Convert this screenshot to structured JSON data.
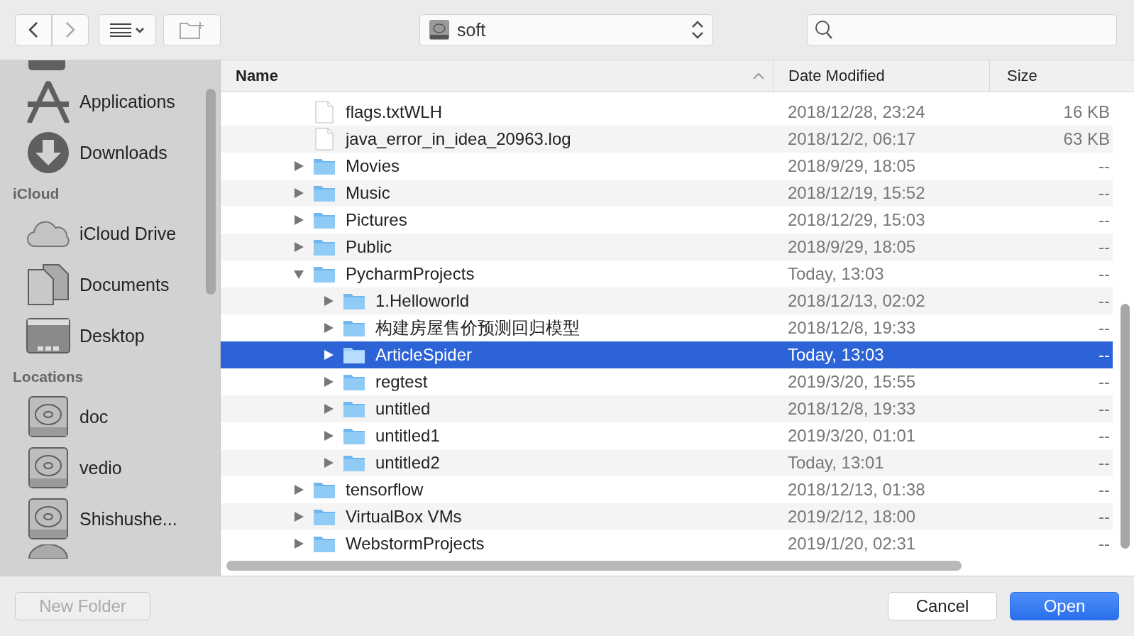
{
  "toolbar": {
    "location": "soft"
  },
  "sidebar": {
    "sections": [
      {
        "items": [
          {
            "label": "Applications",
            "kind": "apps"
          },
          {
            "label": "Downloads",
            "kind": "download"
          }
        ]
      },
      {
        "title": "iCloud",
        "items": [
          {
            "label": "iCloud Drive",
            "kind": "cloud"
          },
          {
            "label": "Documents",
            "kind": "documents"
          },
          {
            "label": "Desktop",
            "kind": "desktop"
          }
        ]
      },
      {
        "title": "Locations",
        "items": [
          {
            "label": "doc",
            "kind": "disk"
          },
          {
            "label": "vedio",
            "kind": "disk"
          },
          {
            "label": "Shishushe...",
            "kind": "disk"
          }
        ]
      }
    ]
  },
  "table": {
    "columns": [
      {
        "label": "Name",
        "sorted": true
      },
      {
        "label": "Date Modified",
        "sorted": false
      },
      {
        "label": "Size",
        "sorted": false
      }
    ],
    "rows": [
      {
        "name": "flags.txtWLH",
        "kind": "file",
        "date": "2018/12/28, 23:24",
        "size": "16 KB",
        "selected": false
      },
      {
        "name": "java_error_in_idea_20963.log",
        "kind": "file",
        "date": "2018/12/2, 06:17",
        "size": "63 KB",
        "selected": false
      },
      {
        "name": "Movies",
        "kind": "folder",
        "expanded": false,
        "date": "2018/9/29, 18:05",
        "size": "--",
        "selected": false
      },
      {
        "name": "Music",
        "kind": "folder",
        "expanded": false,
        "date": "2018/12/19, 15:52",
        "size": "--",
        "selected": false
      },
      {
        "name": "Pictures",
        "kind": "folder",
        "expanded": false,
        "date": "2018/12/29, 15:03",
        "size": "--",
        "selected": false
      },
      {
        "name": "Public",
        "kind": "folder",
        "expanded": false,
        "date": "2018/9/29, 18:05",
        "size": "--",
        "selected": false
      },
      {
        "name": "PycharmProjects",
        "kind": "folder",
        "expanded": true,
        "date": "Today, 13:03",
        "size": "--",
        "selected": false,
        "children": [
          {
            "name": "1.Helloworld",
            "kind": "folder",
            "expanded": false,
            "date": "2018/12/13, 02:02",
            "size": "--",
            "selected": false
          },
          {
            "name": "构建房屋售价预测回归模型",
            "kind": "folder",
            "expanded": false,
            "date": "2018/12/8, 19:33",
            "size": "--",
            "selected": false
          },
          {
            "name": "ArticleSpider",
            "kind": "folder",
            "expanded": false,
            "date": "Today, 13:03",
            "size": "--",
            "selected": true
          },
          {
            "name": "regtest",
            "kind": "folder",
            "expanded": false,
            "date": "2019/3/20, 15:55",
            "size": "--",
            "selected": false
          },
          {
            "name": "untitled",
            "kind": "folder",
            "expanded": false,
            "date": "2018/12/8, 19:33",
            "size": "--",
            "selected": false
          },
          {
            "name": "untitled1",
            "kind": "folder",
            "expanded": false,
            "date": "2019/3/20, 01:01",
            "size": "--",
            "selected": false
          },
          {
            "name": "untitled2",
            "kind": "folder",
            "expanded": false,
            "date": "Today, 13:01",
            "size": "--",
            "selected": false
          }
        ]
      },
      {
        "name": "tensorflow",
        "kind": "folder",
        "expanded": false,
        "date": "2018/12/13, 01:38",
        "size": "--",
        "selected": false
      },
      {
        "name": "VirtualBox VMs",
        "kind": "folder",
        "expanded": false,
        "date": "2019/2/12, 18:00",
        "size": "--",
        "selected": false
      },
      {
        "name": "WebstormProjects",
        "kind": "folder",
        "expanded": false,
        "date": "2019/1/20, 02:31",
        "size": "--",
        "selected": false
      }
    ]
  },
  "buttons": [
    {
      "label": "New Folder",
      "kind": "plain",
      "disabled": true
    },
    {
      "label": "Cancel",
      "kind": "plain",
      "disabled": false
    },
    {
      "label": "Open",
      "kind": "primary",
      "disabled": false
    }
  ]
}
